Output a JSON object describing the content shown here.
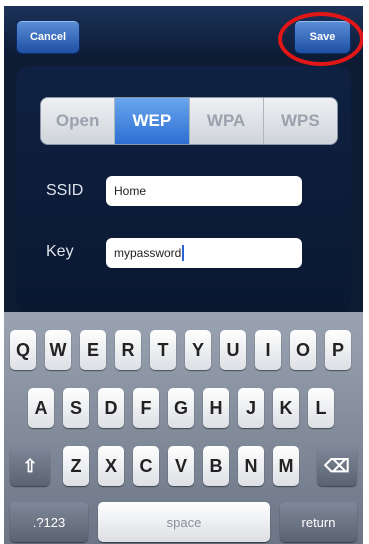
{
  "navbar": {
    "cancel_label": "Cancel",
    "save_label": "Save"
  },
  "security": {
    "tabs": [
      "Open",
      "WEP",
      "WPA",
      "WPS"
    ],
    "selected": "WEP"
  },
  "form": {
    "ssid_label": "SSID",
    "ssid_value": "Home",
    "key_label": "Key",
    "key_value": "mypassword"
  },
  "keyboard": {
    "row1": [
      "Q",
      "W",
      "E",
      "R",
      "T",
      "Y",
      "U",
      "I",
      "O",
      "P"
    ],
    "row2": [
      "A",
      "S",
      "D",
      "F",
      "G",
      "H",
      "J",
      "K",
      "L"
    ],
    "row3": [
      "Z",
      "X",
      "C",
      "V",
      "B",
      "N",
      "M"
    ],
    "shift_icon": "⇧",
    "backspace_icon": "⌫",
    "numbers_label": ".?123",
    "space_label": "space",
    "return_label": "return"
  },
  "colors": {
    "accent_blue": "#2c6fd2",
    "highlight_red": "#e11616"
  }
}
